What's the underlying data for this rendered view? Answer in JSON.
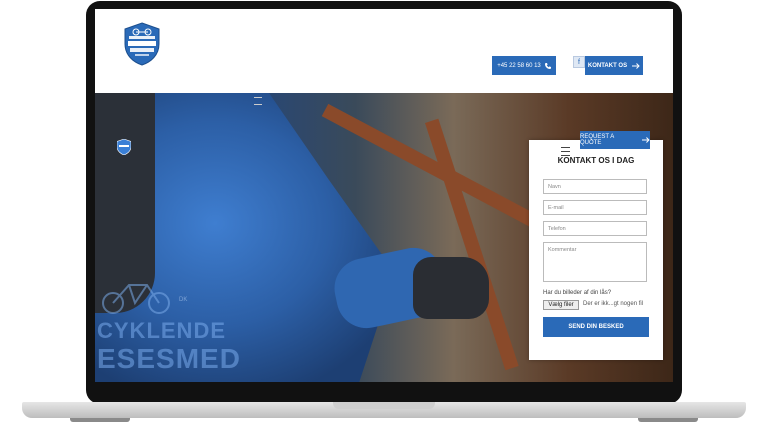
{
  "header": {
    "logo_text": "MOBIL CYKLENDE LÅSESMED",
    "phone_button_label": "+45 22 58 60 13",
    "facebook_icon": "facebook-icon",
    "contact_button_label": "KONTAKT OS"
  },
  "hero": {
    "watermark_line1": "CYKLENDE",
    "watermark_line2": "ESESMED",
    "watermark_sub": "DK",
    "quote_button_label": "REQUEST A QUOTE"
  },
  "form": {
    "title": "KONTAKT OS I DAG",
    "name_placeholder": "Navn",
    "email_placeholder": "E-mail",
    "phone_placeholder": "Telefon",
    "comment_placeholder": "Kommentar",
    "file_question": "Har du billeder af din lås?",
    "file_button_label": "Vælg filer",
    "file_none_text": "Der er ikk...gt nogen fil",
    "send_button_label": "SEND DIN BESKED"
  },
  "colors": {
    "accent": "#2a6ab8"
  }
}
